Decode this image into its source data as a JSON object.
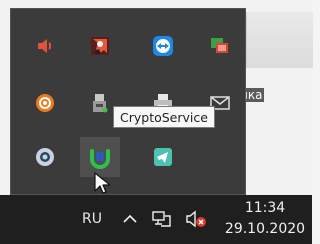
{
  "tooltip": {
    "text": "CryptoService"
  },
  "desktop": {
    "label_fragment": "нка"
  },
  "taskbar": {
    "language": "RU",
    "time": "11:34",
    "date": "29.10.2020"
  },
  "tray_icons": [
    "volume-app-icon",
    "game-app-icon",
    "teamviewer-icon",
    "remote-desktop-icon",
    "avast-icon",
    "usb-device-icon",
    "printer-icon",
    "mail-icon",
    "steam-icon",
    "cryptoservice-icon",
    "telegram-icon"
  ],
  "colors": {
    "tray_bg": "#3b3b3b",
    "taskbar_bg": "#1f1f1f",
    "tooltip_bg": "#f7f7f7",
    "selected_bg": "#4f4f4f"
  }
}
